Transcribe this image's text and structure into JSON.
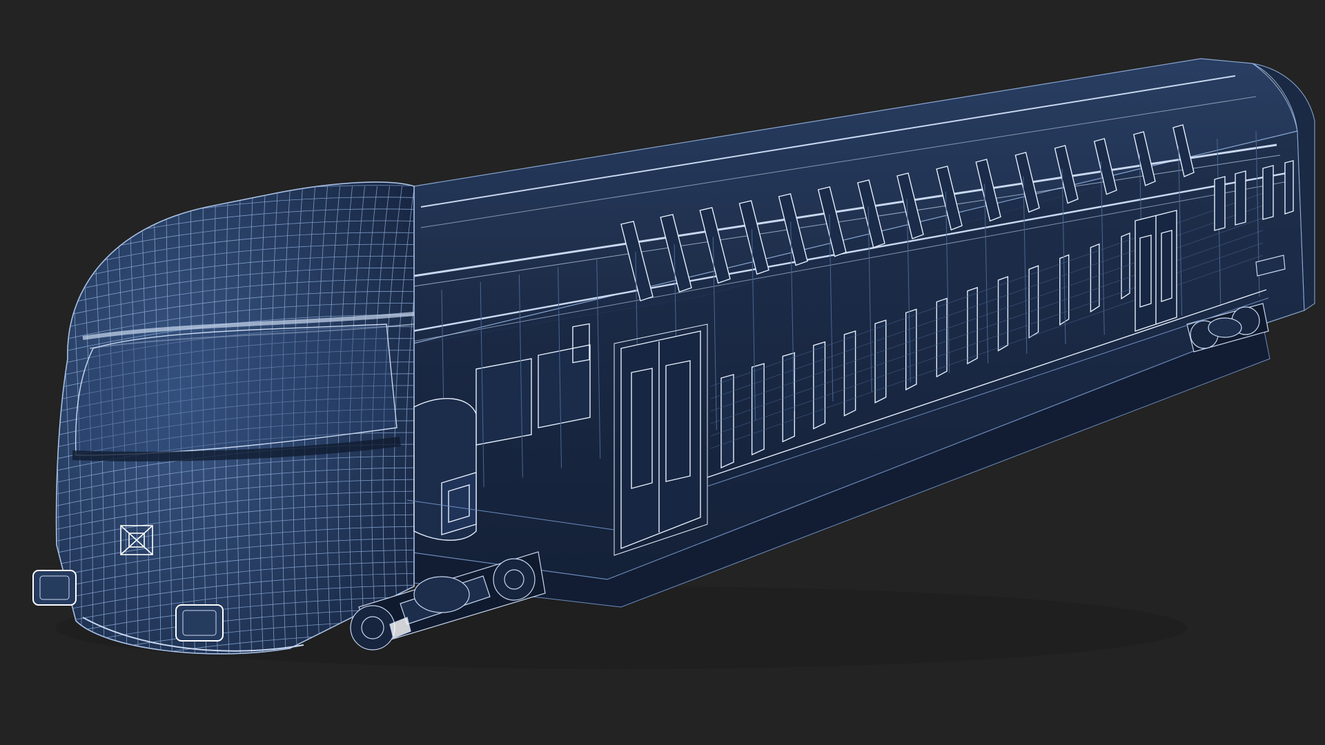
{
  "colors": {
    "background": "#232323",
    "body_fill": "#1c2b44",
    "body_fill_dark": "#121d33",
    "nose_fill": "#223656",
    "wire": "#8faedb",
    "wire_faint": "#4a6894",
    "highlight": "#e6eefb",
    "shadow": "#0d1526"
  },
  "icons": {
    "model": "train-car-wireframe"
  }
}
